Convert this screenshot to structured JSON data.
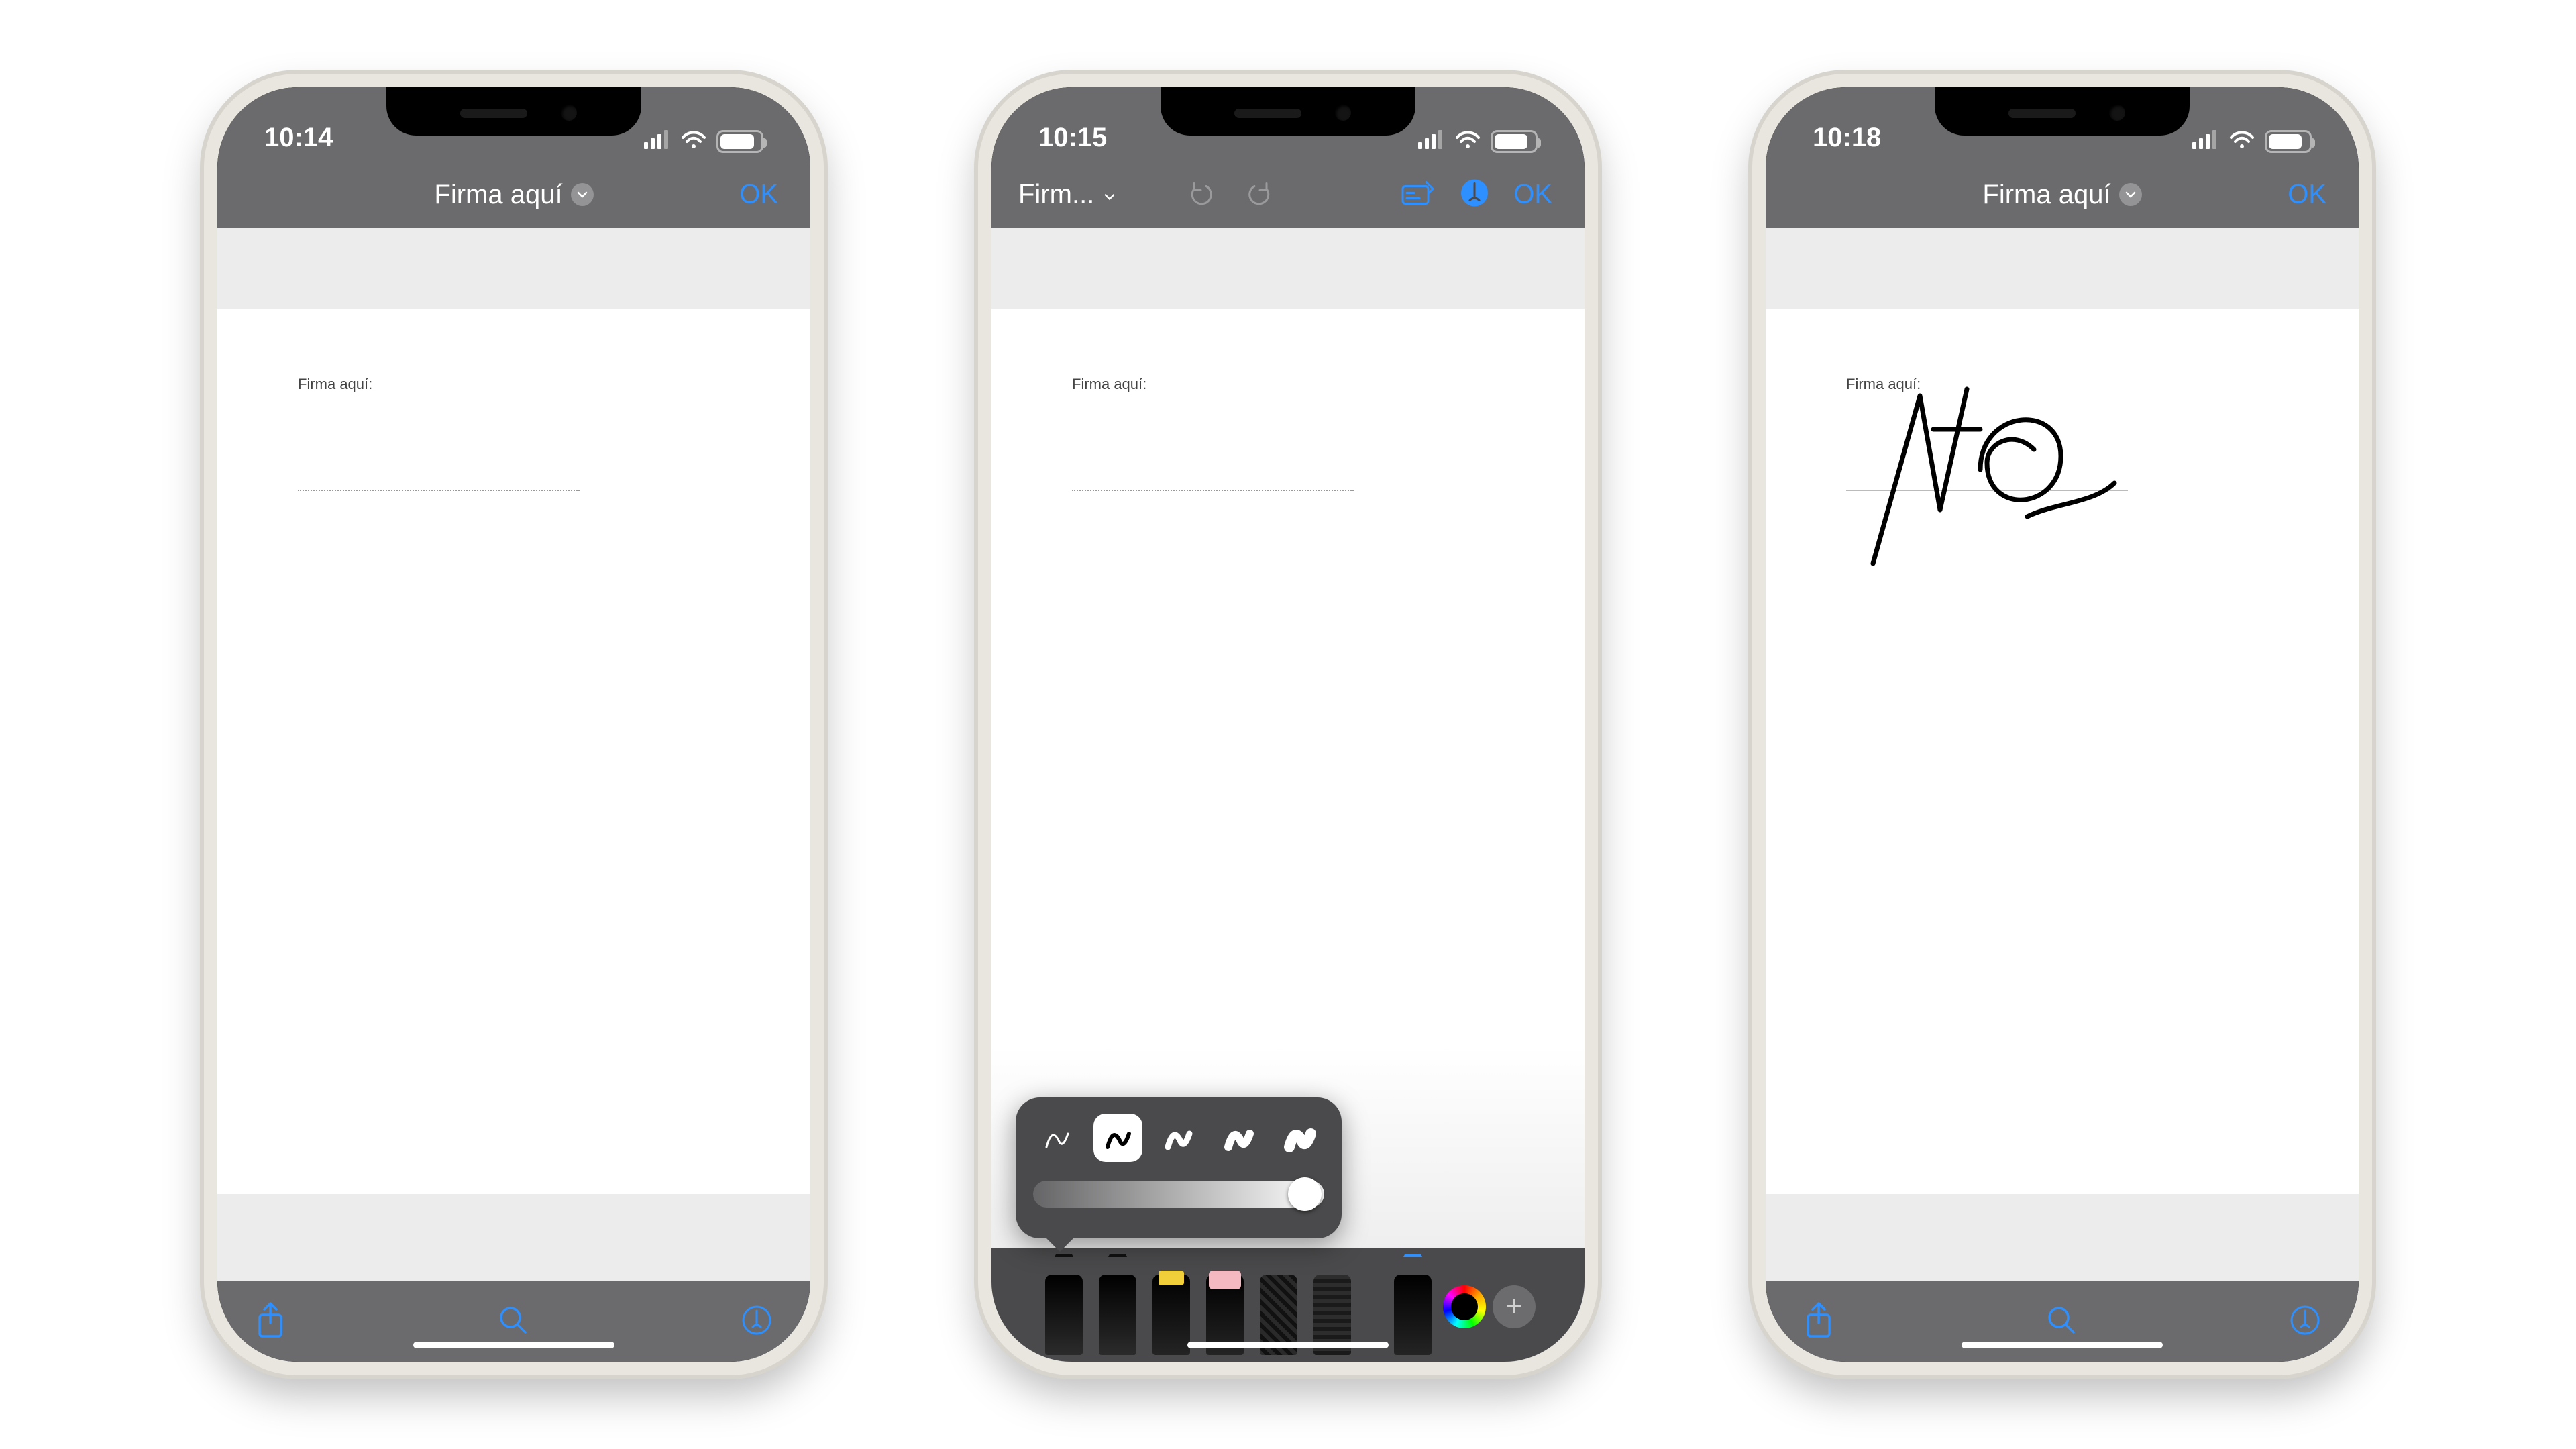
{
  "phone1": {
    "time": "10:14",
    "battery": "78",
    "title": "Firma aquí",
    "ok": "OK",
    "doc_label": "Firma aquí:"
  },
  "phone2": {
    "time": "10:15",
    "battery": "77",
    "title": "Firm...",
    "ok": "OK",
    "doc_label": "Firma aquí:",
    "tools": {
      "add": "+"
    }
  },
  "phone3": {
    "time": "10:18",
    "battery": "77",
    "title": "Firma aquí",
    "ok": "OK",
    "doc_label": "Firma aquí:"
  }
}
